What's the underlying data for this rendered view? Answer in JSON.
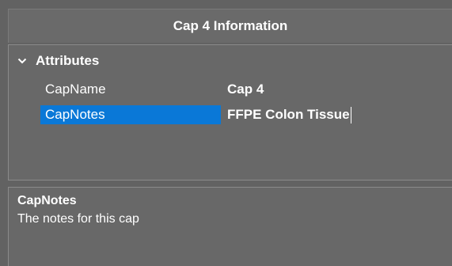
{
  "panel": {
    "title": "Cap 4 Information"
  },
  "grid": {
    "category": {
      "label": "Attributes",
      "icon": "chevron-down-icon",
      "expanded": true
    },
    "properties": [
      {
        "name": "CapName",
        "value": "Cap 4"
      },
      {
        "name": "CapNotes",
        "value": "FFPE Colon Tissue"
      }
    ],
    "selected_property": "CapNotes"
  },
  "description": {
    "title": "CapNotes",
    "text": "The notes for this cap"
  },
  "colors": {
    "background": "#626262",
    "selection": "#0a78d7",
    "text": "#ffffff"
  }
}
